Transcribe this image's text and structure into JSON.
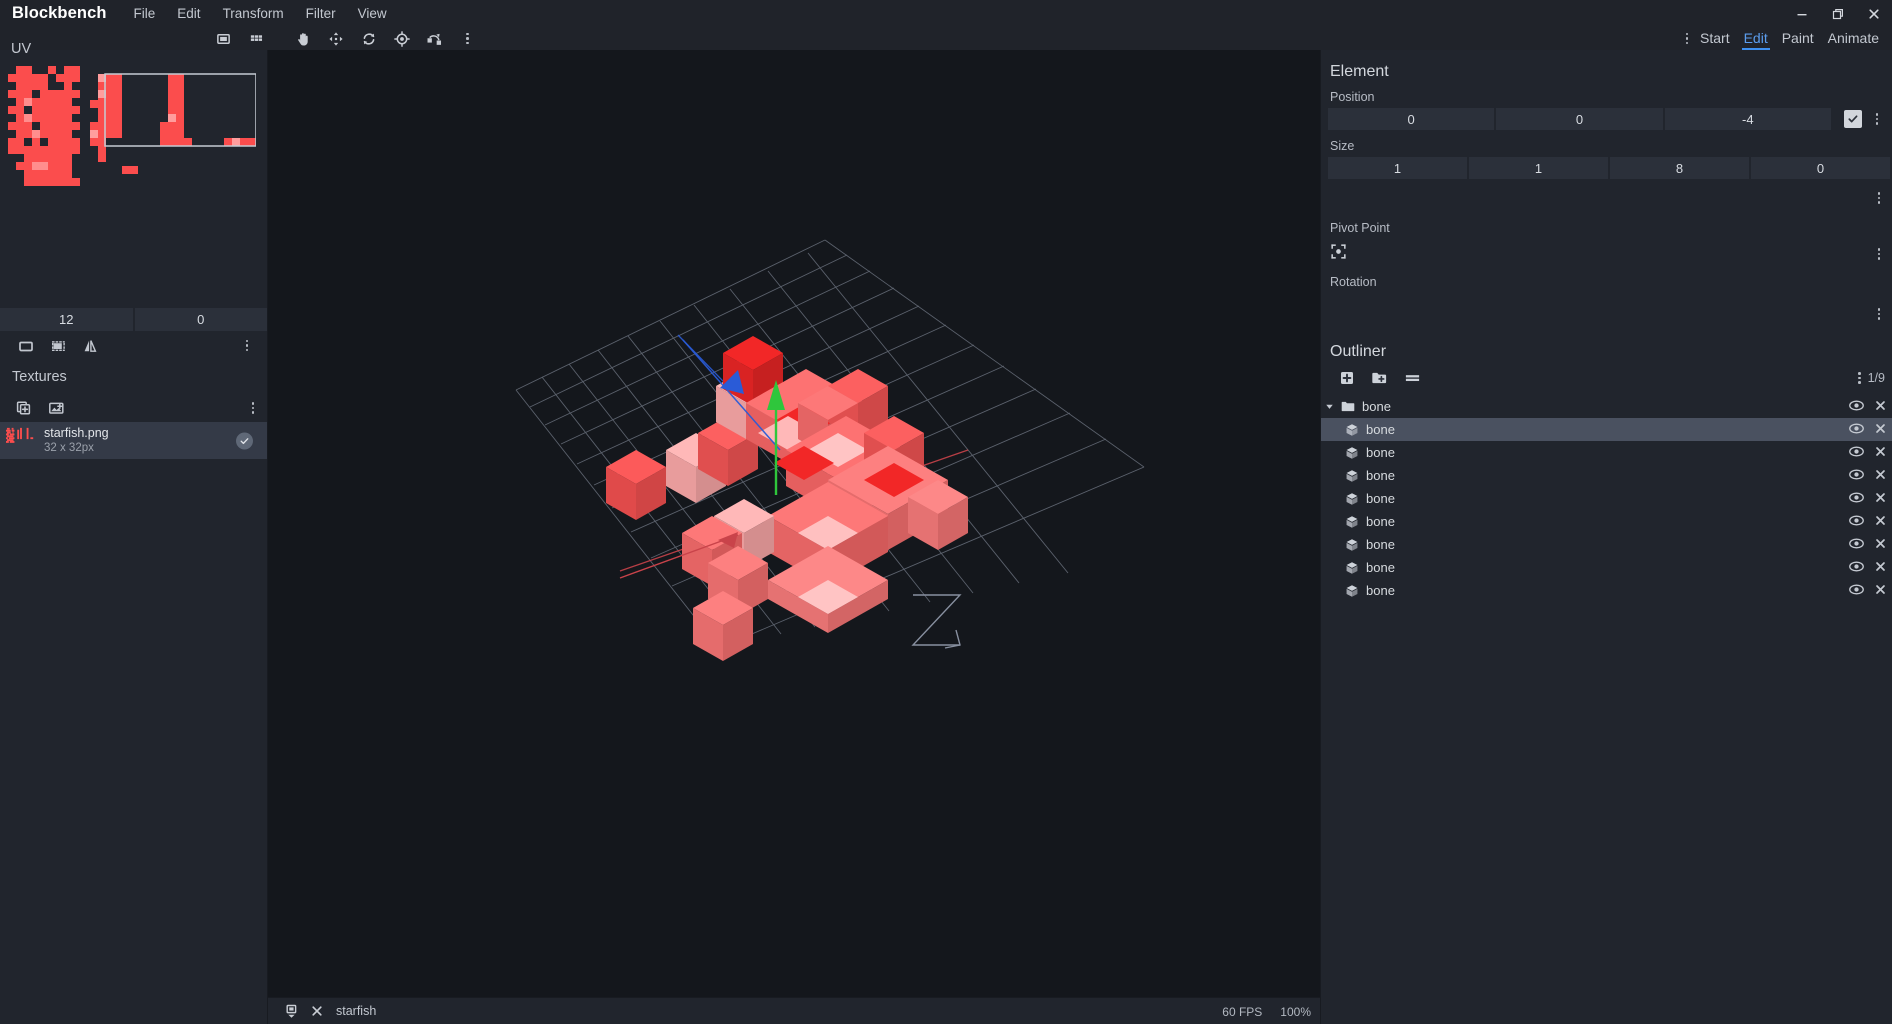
{
  "window": {
    "brand": "Blockbench",
    "menus": [
      "File",
      "Edit",
      "Transform",
      "Filter",
      "View"
    ],
    "controls": {
      "minimize": "minimize-icon",
      "maximize": "restore-icon",
      "close": "close-icon"
    }
  },
  "toolbar": {
    "uv_label": "UV",
    "tools": [
      {
        "name": "single-face-uv-icon",
        "selected": false
      },
      {
        "name": "grid-uv-icon",
        "selected": false
      },
      {
        "name": "move-hand-tool-icon",
        "selected": true
      },
      {
        "name": "resize-tool-icon",
        "selected": false
      },
      {
        "name": "rotate-tool-icon",
        "selected": false
      },
      {
        "name": "pivot-tool-icon",
        "selected": false
      },
      {
        "name": "vertex-snap-tool-icon",
        "selected": false
      }
    ],
    "overflow": "more-options-icon"
  },
  "mode_tabs": {
    "overflow": "more-tabs-icon",
    "items": [
      {
        "label": "Start",
        "active": false
      },
      {
        "label": "Edit",
        "active": true
      },
      {
        "label": "Paint",
        "active": false
      },
      {
        "label": "Animate",
        "active": false
      }
    ]
  },
  "uv_panel": {
    "title": "UV",
    "header_icons": [
      "single-texture-view-icon",
      "all-textures-view-icon"
    ],
    "fields": [
      {
        "name": "uv-size-x",
        "value": "12"
      },
      {
        "name": "uv-size-y",
        "value": "0"
      }
    ],
    "tool_icons": [
      "uv-select-face-icon",
      "uv-auto-icon",
      "uv-mirror-icon"
    ],
    "overflow": "more-options-icon"
  },
  "textures_panel": {
    "title": "Textures",
    "tool_icons": [
      "add-texture-icon",
      "create-texture-icon"
    ],
    "overflow": "more-options-icon",
    "items": [
      {
        "name": "starfish.png",
        "size": "32 x 32px",
        "selected": true,
        "check": "check-icon"
      }
    ]
  },
  "element_panel": {
    "title": "Element",
    "position": {
      "label": "Position",
      "values": [
        "0",
        "0",
        "-4"
      ],
      "checkbox_checked": true,
      "overflow": "more-options-icon"
    },
    "size": {
      "label": "Size",
      "values": [
        "1",
        "1",
        "8",
        "0"
      ],
      "overflow": "more-options-icon"
    },
    "pivot": {
      "label": "Pivot Point",
      "icon": "pivot-center-icon",
      "overflow": "more-options-icon"
    },
    "rotation": {
      "label": "Rotation",
      "overflow": "more-options-icon"
    }
  },
  "outliner": {
    "title": "Outliner",
    "tools": [
      "add-cube-icon",
      "add-group-icon",
      "toggle-list-icon"
    ],
    "overflow": "more-options-icon",
    "count": "1/9",
    "nodes": [
      {
        "label": "bone",
        "type": "group",
        "depth": 0,
        "expanded": true,
        "selected": false,
        "visible": true
      },
      {
        "label": "bone",
        "type": "cube",
        "depth": 1,
        "selected": true,
        "visible": true
      },
      {
        "label": "bone",
        "type": "cube",
        "depth": 1,
        "selected": false,
        "visible": true
      },
      {
        "label": "bone",
        "type": "cube",
        "depth": 1,
        "selected": false,
        "visible": true
      },
      {
        "label": "bone",
        "type": "cube",
        "depth": 1,
        "selected": false,
        "visible": true
      },
      {
        "label": "bone",
        "type": "cube",
        "depth": 1,
        "selected": false,
        "visible": true
      },
      {
        "label": "bone",
        "type": "cube",
        "depth": 1,
        "selected": false,
        "visible": true
      },
      {
        "label": "bone",
        "type": "cube",
        "depth": 1,
        "selected": false,
        "visible": true
      },
      {
        "label": "bone",
        "type": "cube",
        "depth": 1,
        "selected": false,
        "visible": true
      }
    ],
    "row_icons": {
      "visibility": "eye-icon",
      "remove": "close-icon"
    }
  },
  "statusbar": {
    "save_icon": "save-status-icon",
    "close_icon": "close-icon",
    "project_name": "starfish",
    "fps": "60 FPS",
    "zoom": "100%"
  },
  "colors": {
    "accent": "#3e90f0",
    "panel_bg": "#21252d",
    "titlebar_bg": "#20232a",
    "viewport_bg": "#14171c",
    "field_bg": "#2b303a",
    "selected_row": "#4a5160",
    "texture_red": "#fb4d4d",
    "axis_x": "#c9434a",
    "axis_y": "#2fc63c",
    "axis_z": "#2a5bd7",
    "text": "#c3c8d0"
  }
}
